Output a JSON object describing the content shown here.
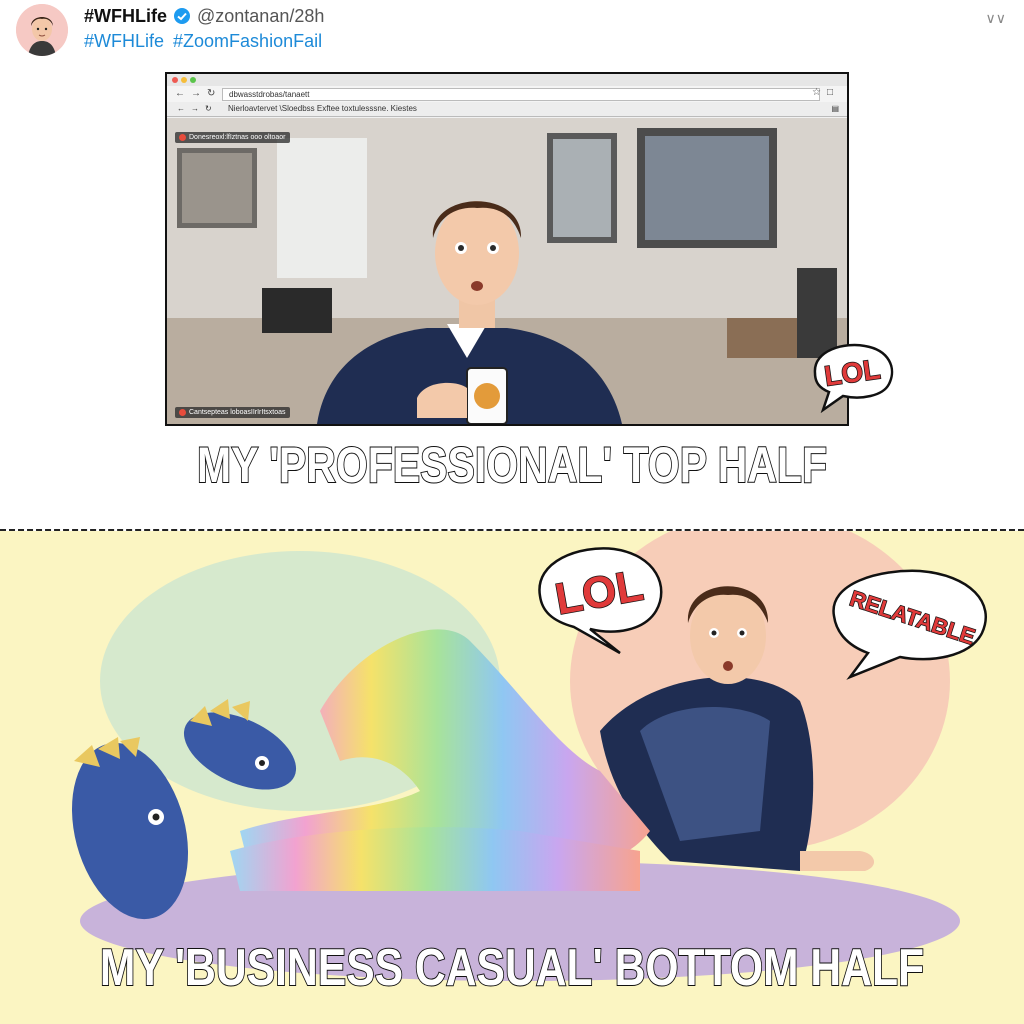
{
  "tweet": {
    "display_name": "#WFHLife",
    "handle": "@zontanan/28h",
    "hashtags": [
      "#WFHLife",
      "#ZoomFashionFail"
    ],
    "menu_icon": "chevron-down-icon"
  },
  "browser": {
    "address": "dbwasstdrobas/tanaett",
    "bookmarks": "Nierloavtervet \\Sloedbss  Exftee  toxtulesssne. Kiestes",
    "video_label_top": "Donesreoxl:lfIztnas ooo oltoaor",
    "video_label_bottom": "Cantsepteas loboasIIrIrItsxtoas"
  },
  "captions": {
    "top": "MY 'PROFESSIONAL' TOP HALF",
    "bottom": "MY 'BUSINESS CASUAL' BOTTOM HALF"
  },
  "bubbles": {
    "top_lol": "LOL",
    "bottom_lol": "LOL",
    "relatable": "RELATABLE"
  },
  "colors": {
    "hashtag_blue": "#1d8ad8",
    "verified_blue": "#1d9bf0",
    "bottom_background": "#fbf5c2",
    "bubble_text_red": "#e03a3a"
  }
}
